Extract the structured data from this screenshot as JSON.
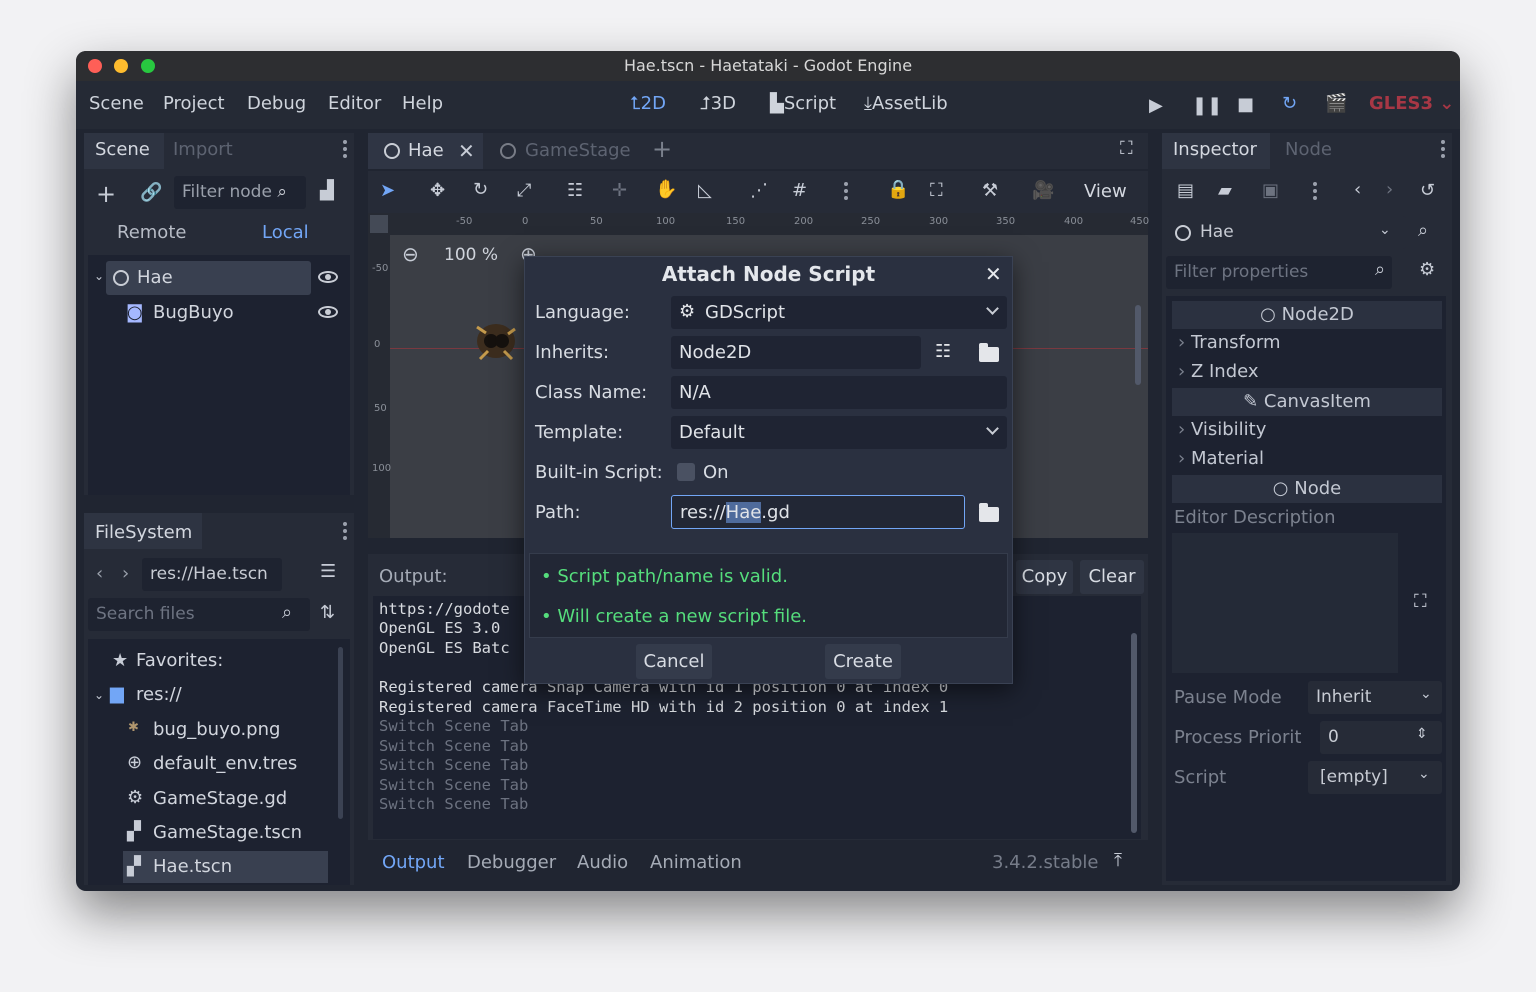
{
  "window": {
    "title": "Hae.tscn - Haetataki - Godot Engine"
  },
  "menu": {
    "items": [
      "Scene",
      "Project",
      "Debug",
      "Editor",
      "Help"
    ]
  },
  "workspaces": {
    "w2d": "2D",
    "w3d": "3D",
    "script": "Script",
    "assetlib": "AssetLib"
  },
  "renderer": "GLES3",
  "scene_dock": {
    "tabs": [
      "Scene",
      "Import"
    ],
    "filter_placeholder": "Filter node",
    "remote": "Remote",
    "local": "Local",
    "nodes": [
      "Hae",
      "BugBuyo"
    ]
  },
  "filesystem": {
    "tab": "FileSystem",
    "path": "res://Hae.tscn",
    "search_placeholder": "Search files",
    "favorites": "Favorites:",
    "root": "res://",
    "files": [
      "bug_buyo.png",
      "default_env.tres",
      "GameStage.gd",
      "GameStage.tscn",
      "Hae.tscn"
    ]
  },
  "editor_tabs": {
    "tab1": "Hae",
    "tab2": "GameStage"
  },
  "viewport": {
    "view_label": "View",
    "zoom": "100 %",
    "ruler_top": [
      "-50",
      "0",
      "50",
      "100",
      "150",
      "200",
      "250",
      "300",
      "350",
      "400",
      "450"
    ],
    "ruler_left": [
      "-50",
      "0",
      "50",
      "100"
    ]
  },
  "output": {
    "label": "Output:",
    "copy": "Copy",
    "clear": "Clear",
    "lines": [
      "https://godote",
      "OpenGL ES 3.0",
      "OpenGL ES Batc",
      "",
      "Registered camera Snap Camera with id 1 position 0 at index 0",
      "Registered camera FaceTime HD with id 2 position 0 at index 1"
    ],
    "dim_lines": [
      "Switch Scene Tab",
      "Switch Scene Tab",
      "Switch Scene Tab",
      "Switch Scene Tab",
      "Switch Scene Tab"
    ]
  },
  "bottom_tabs": {
    "output": "Output",
    "debugger": "Debugger",
    "audio": "Audio",
    "animation": "Animation",
    "version": "3.4.2.stable"
  },
  "inspector": {
    "tabs": [
      "Inspector",
      "Node"
    ],
    "object": "Hae",
    "filter_placeholder": "Filter properties",
    "sections": {
      "node2d": "Node2D",
      "canvasitem": "CanvasItem",
      "node": "Node"
    },
    "items": {
      "transform": "Transform",
      "zindex": "Z Index",
      "visibility": "Visibility",
      "material": "Material"
    },
    "editor_description": "Editor Description",
    "pause_mode_label": "Pause Mode",
    "pause_mode_value": "Inherit",
    "process_priority_label": "Process Priorit",
    "process_priority_value": "0",
    "script_label": "Script",
    "script_value": "[empty]"
  },
  "dialog": {
    "title": "Attach Node Script",
    "language_label": "Language:",
    "language_value": "GDScript",
    "inherits_label": "Inherits:",
    "inherits_value": "Node2D",
    "classname_label": "Class Name:",
    "classname_value": "N/A",
    "template_label": "Template:",
    "template_value": "Default",
    "builtin_label": "Built-in Script:",
    "builtin_value": "On",
    "path_label": "Path:",
    "path_prefix": "res://",
    "path_selected": "Hae",
    "path_suffix": ".gd",
    "msg1": "• Script path/name is valid.",
    "msg2": "• Will create a new script file.",
    "cancel": "Cancel",
    "create": "Create"
  }
}
